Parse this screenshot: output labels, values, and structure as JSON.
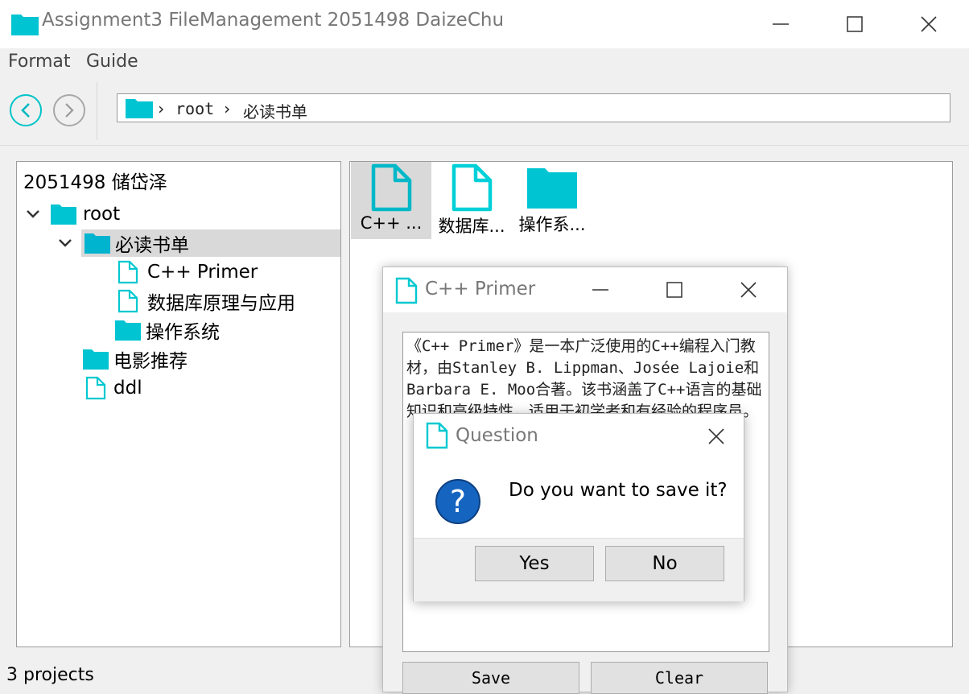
{
  "window": {
    "title": "Assignment3 FileManagement 2051498 DaizeChu"
  },
  "menu": {
    "items": [
      "Format",
      "Guide"
    ]
  },
  "path": {
    "segments": [
      "root",
      "必读书单"
    ]
  },
  "tree": {
    "header": "2051498 储岱泽",
    "items": [
      {
        "label": "root",
        "type": "folder"
      },
      {
        "label": "必读书单",
        "type": "folder"
      },
      {
        "label": "C++ Primer",
        "type": "file"
      },
      {
        "label": "数据库原理与应用",
        "type": "file"
      },
      {
        "label": "操作系统",
        "type": "folder"
      },
      {
        "label": "电影推荐",
        "type": "folder"
      },
      {
        "label": "ddl",
        "type": "file"
      }
    ]
  },
  "view": {
    "items": [
      {
        "label": "C++ ...",
        "type": "file"
      },
      {
        "label": "数据库...",
        "type": "file"
      },
      {
        "label": "操作系...",
        "type": "folder"
      }
    ]
  },
  "status": "3 projects",
  "editor": {
    "title": "C++ Primer",
    "content": "《C++ Primer》是一本广泛使用的C++编程入门教材，由Stanley B. Lippman、Josée Lajoie和Barbara E. Moo合著。该书涵盖了C++语言的基础知识和高级特性，适用于初学者和有经验的程序员。",
    "save_label": "Save",
    "clear_label": "Clear"
  },
  "question": {
    "title": "Question",
    "message": "Do you want to save it?",
    "yes_label": "Yes",
    "no_label": "No"
  },
  "colors": {
    "accent": "#00c8d2",
    "folder": "#00c0d0",
    "question_icon": "#1565c0"
  }
}
